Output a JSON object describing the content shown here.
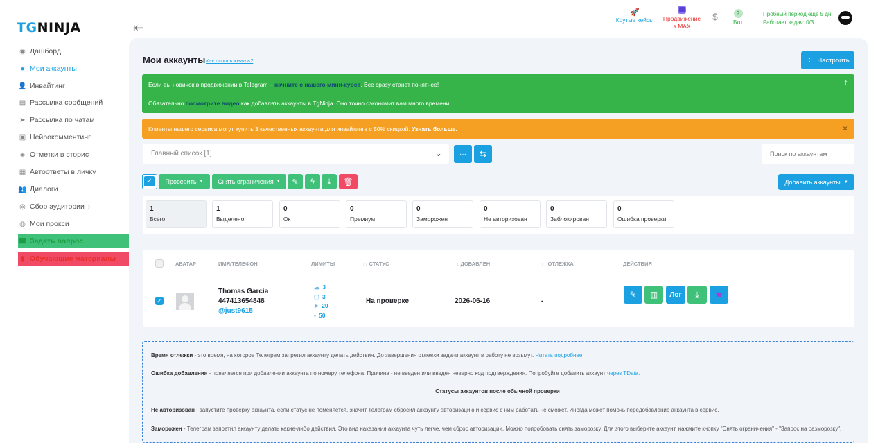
{
  "logo": {
    "tg": "TG",
    "ninja": "NINJA"
  },
  "sidebar": {
    "items": [
      {
        "label": "Дашборд"
      },
      {
        "label": "Мои аккаунты"
      },
      {
        "label": "Инвайтинг"
      },
      {
        "label": "Рассылка сообщений"
      },
      {
        "label": "Рассылка по чатам"
      },
      {
        "label": "Нейрокомментинг"
      },
      {
        "label": "Отметки в сторис"
      },
      {
        "label": "Автоответы в личку"
      },
      {
        "label": "Диалоги"
      },
      {
        "label": "Сбор аудитории"
      },
      {
        "label": "Мои прокси"
      },
      {
        "label": "Задать вопрос"
      },
      {
        "label": "Обучающие материалы"
      }
    ]
  },
  "topbar": {
    "cases": "Крутые кейсы",
    "promo_line1": "Продвижение",
    "promo_line2": "в MAX",
    "dollar": "$",
    "bot_icon": "?",
    "bot": "Бот",
    "trial": "Пробный период ещё 5 дн.",
    "tasks": "Работает задач: 0/3"
  },
  "page": {
    "title": "Мои аккаунты",
    "howto": "Как использовать?",
    "configure": "Настроить"
  },
  "banner_green": {
    "l1_a": "Если вы новичок в продвижении в Telegram – ",
    "l1_link": "начните с нашего мини-курса",
    "l1_b": ". Все сразу станет понятнее!",
    "l2_a": "Обязательно ",
    "l2_link": "посмотрите видео",
    "l2_b": " как добавлять аккаунты в TgNinja. Оно точно сэкономит вам много времени!"
  },
  "banner_orange": {
    "text": "Клиенты нашего сервиса могут купить 3 качественных аккаунта для инвайтинга с 50% скидкой. ",
    "link": "Узнать больше.",
    "close": "×"
  },
  "toolbar": {
    "list_value": "Главный список [1]",
    "more": "···",
    "swap": "⇆",
    "search_placeholder": "Поиск по аккаунтам",
    "check": "Проверить",
    "unlimit": "Снять ограничения",
    "add": "Добавить аккаунты"
  },
  "stats": [
    {
      "value": "1",
      "label": "Всего"
    },
    {
      "value": "1",
      "label": "Выделено"
    },
    {
      "value": "0",
      "label": "Ок"
    },
    {
      "value": "0",
      "label": "Премиум"
    },
    {
      "value": "0",
      "label": "Заморожен"
    },
    {
      "value": "0",
      "label": "Не авторизован"
    },
    {
      "value": "0",
      "label": "Заблокирован"
    },
    {
      "value": "0",
      "label": "Ошибка проверки"
    }
  ],
  "table": {
    "headers": [
      "АВАТАР",
      "ИМЯ/ТЕЛЕФОН",
      "ЛИМИТЫ",
      "СТАТУС",
      "ДОБАВЛЕН",
      "ОТЛЕЖКА",
      "ДЕЙСТВИЯ"
    ],
    "sort_icon": "↑↓",
    "row": {
      "name": "Thomas Garcia",
      "phone": "447413654848",
      "username": "@just9615",
      "limits": [
        "3",
        "3",
        "20",
        "50"
      ],
      "status": "На проверке",
      "added": "2026-06-16",
      "cooldown": "-",
      "log": "Лог"
    }
  },
  "notes": {
    "p1_b": "Время отлежки",
    "p1": " - это время, на которое Телеграм запретил аккаунту делать действия. До завершения отлежки задачи аккаунт в работу не возьмут. ",
    "p1_link": "Читать подробнее.",
    "p2_b": "Ошибка добавления",
    "p2": " - появляется при добавлении аккаунта по номеру телефона. Причина - не введен или введен неверно код подтверждения. Попробуйте добавить аккаунт ",
    "p2_link": "через TData.",
    "heading": "Статусы аккаунтов после обычной проверки",
    "p3_b": "Не авторизован",
    "p3": " - запустите проверку аккаунта, если статус не поменяется, значит Телеграм сбросил аккаунту авторизацию и сервис с ним работать не сможет. Иногда может помочь передобавление аккаунта в сервис.",
    "p4_b": "Заморожен",
    "p4": " - Телеграм запретил аккаунту делать какие-либо действия. Это вид наказания аккаунта чуть легче, чем сброс авторизации. Можно попробовать снять заморозку. Для этого выберите аккаунт, нажмите кнопку \"Снять ограничения\" - \"Запрос на разморозку\"."
  },
  "colors": {
    "accent": "#1ba0e2",
    "success": "#36b449",
    "warning": "#f5a023",
    "danger": "#f04a64",
    "action_green": "#3fc17a"
  }
}
